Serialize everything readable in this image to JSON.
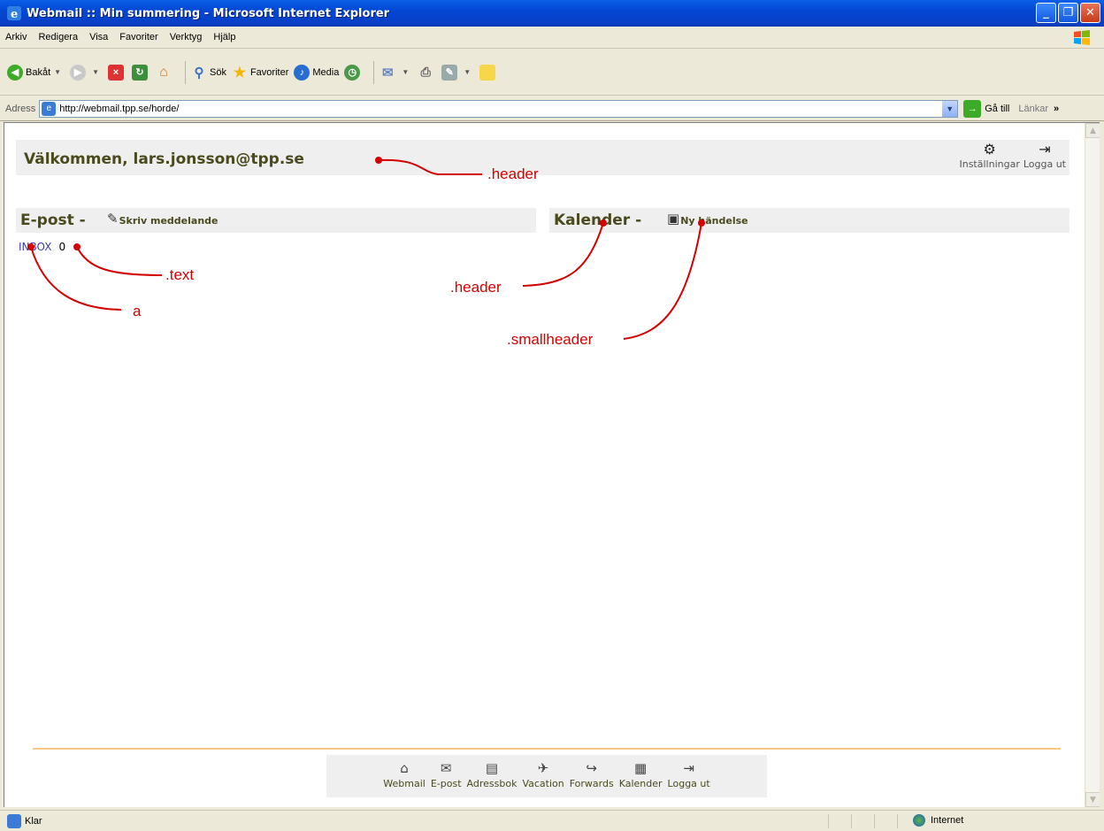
{
  "window": {
    "title": "Webmail :: Min summering - Microsoft Internet Explorer"
  },
  "menu": [
    "Arkiv",
    "Redigera",
    "Visa",
    "Favoriter",
    "Verktyg",
    "Hjälp"
  ],
  "toolbar": {
    "back": "Bakåt",
    "search": "Sök",
    "favorites": "Favoriter",
    "media": "Media"
  },
  "address": {
    "label": "Adress",
    "url": "http://webmail.tpp.se/horde/",
    "go": "Gå till",
    "links": "Länkar"
  },
  "page": {
    "welcome": "Välkommen, lars.jonsson@tpp.se",
    "settings": "Inställningar",
    "logout": "Logga ut",
    "email_title": "E-post -",
    "compose": "Skriv meddelande",
    "calendar_title": "Kalender -",
    "new_event": "Ny händelse",
    "inbox": "INBOX",
    "inbox_count": "0"
  },
  "annotations": {
    "header_top": ".header",
    "text": ".text",
    "a": "a",
    "header_mid": ".header",
    "smallheader": ".smallheader"
  },
  "nav": [
    "Webmail",
    "E-post",
    "Adressbok",
    "Vacation",
    "Forwards",
    "Kalender",
    "Logga ut"
  ],
  "status": {
    "left": "Klar",
    "zone": "Internet"
  },
  "colors": {
    "titlebar": "#0a3fc4",
    "header_text": "#4a4a1e",
    "header_bg": "#efefef",
    "annotation": "#d40000",
    "link": "#3b3bb0",
    "divider": "#f9c68c"
  }
}
